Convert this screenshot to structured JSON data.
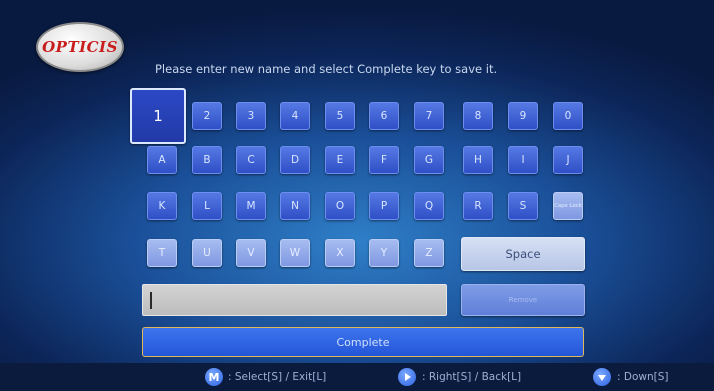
{
  "logo": {
    "text": "OPTICIS"
  },
  "instruction": "Please enter new name and select Complete key to save it.",
  "keys": {
    "row1": [
      "1",
      "2",
      "3",
      "4",
      "5",
      "6",
      "7",
      "8",
      "9",
      "0"
    ],
    "row2": [
      "A",
      "B",
      "C",
      "D",
      "E",
      "F",
      "G",
      "H",
      "I",
      "J"
    ],
    "row3": [
      "K",
      "L",
      "M",
      "N",
      "O",
      "P",
      "Q",
      "R",
      "S",
      "Caps Lock"
    ],
    "row4": [
      "T",
      "U",
      "V",
      "W",
      "X",
      "Y",
      "Z"
    ],
    "space": "Space",
    "delete": "Remove"
  },
  "name_field": {
    "value": ""
  },
  "complete": "Complete",
  "help": {
    "m_icon": "M",
    "select": ": Select[S] / Exit[L]",
    "right_icon": "play-right-icon",
    "right": ": Right[S] / Back[L]",
    "down_icon": "chevron-down-icon",
    "down": ": Down[S]"
  },
  "colors": {
    "key_blue": "#3a5cd8",
    "selected_border": "#dce8ff",
    "complete_border": "#e0b85a"
  }
}
